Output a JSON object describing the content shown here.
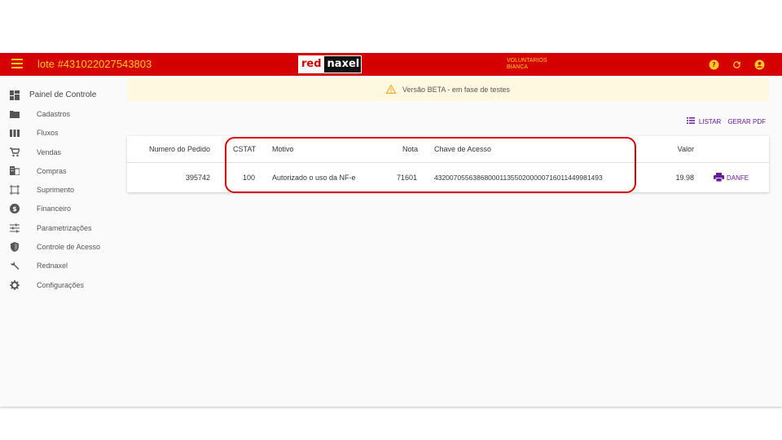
{
  "header": {
    "title": "lote #431022027543803",
    "logo_red": "red",
    "logo_naxel": "naxel",
    "user_line1": "VOLUNTARIOS",
    "user_line2": "BIANCA",
    "colors": {
      "bar": "#d50000",
      "accent": "#ffca28"
    },
    "icons": [
      "help-icon",
      "refresh-icon",
      "account-icon"
    ]
  },
  "sidebar": {
    "items": [
      {
        "label": "Painel de Controle",
        "icon": "dashboard-icon"
      },
      {
        "label": "Cadastros",
        "icon": "folder-icon"
      },
      {
        "label": "Fluxos",
        "icon": "columns-icon"
      },
      {
        "label": "Vendas",
        "icon": "cart-icon"
      },
      {
        "label": "Compras",
        "icon": "domain-icon"
      },
      {
        "label": "Suprimento",
        "icon": "crop-icon"
      },
      {
        "label": "Financeiro",
        "icon": "dollar-icon"
      },
      {
        "label": "Parametrizações",
        "icon": "tune-icon"
      },
      {
        "label": "Controle de Acesso",
        "icon": "shield-icon"
      },
      {
        "label": "Rednaxel",
        "icon": "wrench-icon"
      },
      {
        "label": "Configurações",
        "icon": "gear-icon"
      }
    ]
  },
  "banner": {
    "text": "Versão BETA - em fase de testes",
    "icon": "warning-icon"
  },
  "actions": {
    "list_label": "LISTAR",
    "pdf_label": "GERAR PDF"
  },
  "table": {
    "headers": {
      "pedido": "Numero do Pedido",
      "cstat": "CSTAT",
      "motivo": "Motivo",
      "nota": "Nota",
      "chave": "Chave de Acesso",
      "valor": "Valor"
    },
    "rows": [
      {
        "pedido": "395742",
        "cstat": "100",
        "motivo": "Autorizado o uso da NF-e",
        "nota": "71601",
        "chave": "43200705563868000113550200000716011449981493",
        "valor": "19.98",
        "action": "DANFE"
      }
    ]
  }
}
